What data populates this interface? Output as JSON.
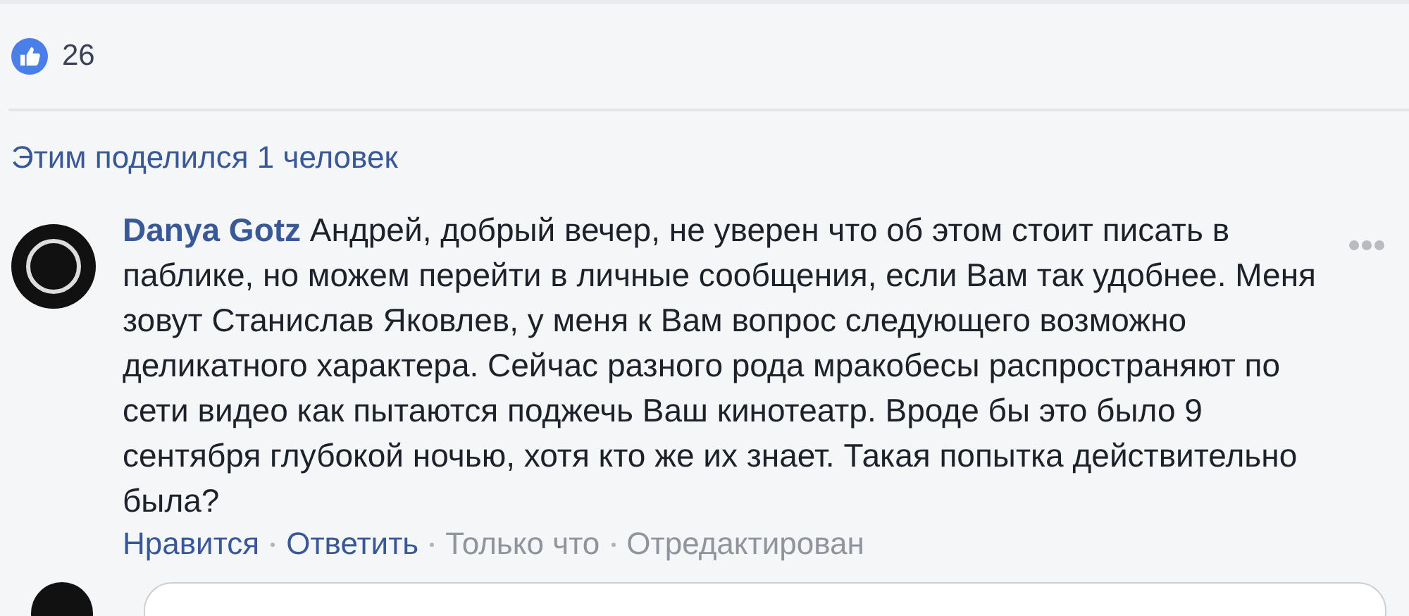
{
  "reactions": {
    "count": "26"
  },
  "shares": "Этим поделился 1 человек",
  "comment": {
    "author": "Danya Gotz",
    "text": "Андрей, добрый вечер, не уверен что об этом стоит писать в паблике, но можем перейти в личные сообщения, если Вам так удобнее. Меня зовут Станислав Яковлев, у меня к Вам вопрос следующего возможно деликатного характера. Сейчас разного рода мракобесы распространяют по сети видео как пытаются поджечь Ваш кинотеатр. Вроде бы это было 9 сентября глубокой ночью, хотя кто же их знает. Такая попытка действительно была?",
    "actions": [
      {
        "label": "Нравится",
        "kind": "link"
      },
      {
        "label": "Ответить",
        "kind": "link"
      },
      {
        "label": "Только что",
        "kind": "meta"
      },
      {
        "label": "Отредактирован",
        "kind": "meta"
      }
    ]
  }
}
